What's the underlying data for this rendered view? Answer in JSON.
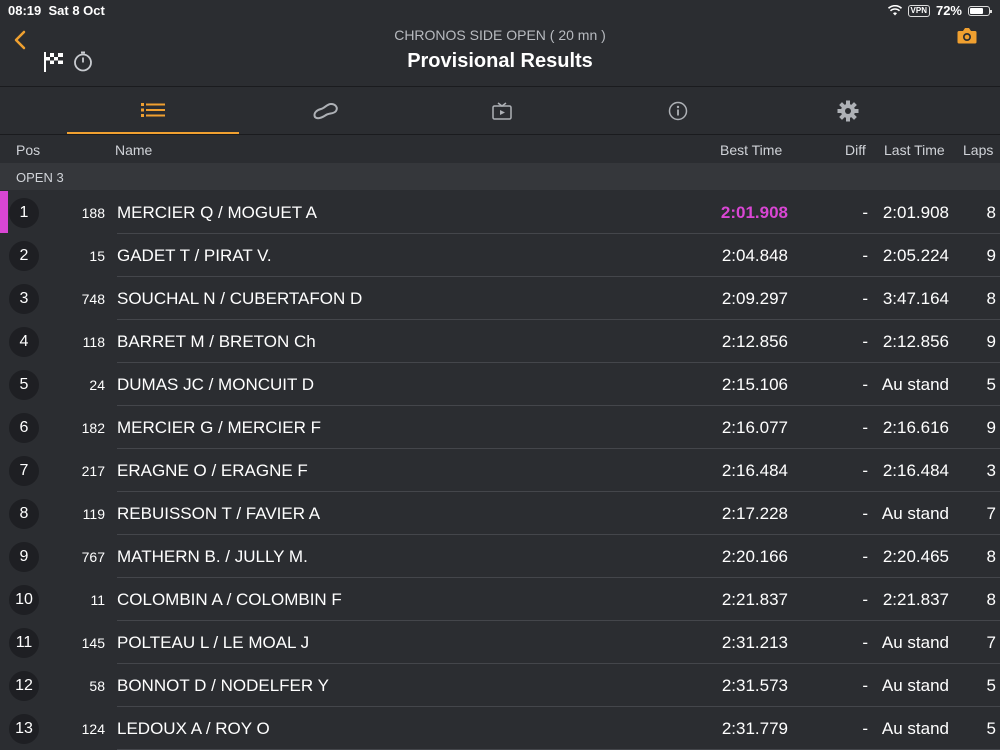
{
  "status": {
    "time": "08:19",
    "date": "Sat 8 Oct",
    "vpn": "VPN",
    "battery": "72%"
  },
  "header": {
    "subtitle": "CHRONOS SIDE OPEN ( 20 mn )",
    "title": "Provisional Results"
  },
  "colors": {
    "accent": "#f0a030",
    "fastest": "#d946d4",
    "background": "#2b2d31"
  },
  "tabs": [
    "list-icon",
    "track-icon",
    "tv-icon",
    "info-icon",
    "gear-icon"
  ],
  "columns": {
    "pos": "Pos",
    "name": "Name",
    "best": "Best Time",
    "diff": "Diff",
    "last": "Last Time",
    "laps": "Laps"
  },
  "group": "OPEN 3",
  "rows": [
    {
      "pos": "1",
      "num": "188",
      "name": "MERCIER Q / MOGUET A",
      "best": "2:01.908",
      "diff": "-",
      "last": "2:01.908",
      "laps": "8"
    },
    {
      "pos": "2",
      "num": "15",
      "name": "GADET T / PIRAT V.",
      "best": "2:04.848",
      "diff": "-",
      "last": "2:05.224",
      "laps": "9"
    },
    {
      "pos": "3",
      "num": "748",
      "name": "SOUCHAL N / CUBERTAFON D",
      "best": "2:09.297",
      "diff": "-",
      "last": "3:47.164",
      "laps": "8"
    },
    {
      "pos": "4",
      "num": "118",
      "name": "BARRET M / BRETON Ch",
      "best": "2:12.856",
      "diff": "-",
      "last": "2:12.856",
      "laps": "9"
    },
    {
      "pos": "5",
      "num": "24",
      "name": "DUMAS JC / MONCUIT D",
      "best": "2:15.106",
      "diff": "-",
      "last": "Au stand",
      "laps": "5"
    },
    {
      "pos": "6",
      "num": "182",
      "name": "MERCIER G / MERCIER F",
      "best": "2:16.077",
      "diff": "-",
      "last": "2:16.616",
      "laps": "9"
    },
    {
      "pos": "7",
      "num": "217",
      "name": "ERAGNE O / ERAGNE F",
      "best": "2:16.484",
      "diff": "-",
      "last": "2:16.484",
      "laps": "3"
    },
    {
      "pos": "8",
      "num": "119",
      "name": "REBUISSON T / FAVIER A",
      "best": "2:17.228",
      "diff": "-",
      "last": "Au stand",
      "laps": "7"
    },
    {
      "pos": "9",
      "num": "767",
      "name": "MATHERN B. / JULLY M.",
      "best": "2:20.166",
      "diff": "-",
      "last": "2:20.465",
      "laps": "8"
    },
    {
      "pos": "10",
      "num": "11",
      "name": "COLOMBIN A / COLOMBIN F",
      "best": "2:21.837",
      "diff": "-",
      "last": "2:21.837",
      "laps": "8"
    },
    {
      "pos": "11",
      "num": "145",
      "name": "POLTEAU L / LE MOAL J",
      "best": "2:31.213",
      "diff": "-",
      "last": "Au stand",
      "laps": "7"
    },
    {
      "pos": "12",
      "num": "58",
      "name": "BONNOT D / NODELFER Y",
      "best": "2:31.573",
      "diff": "-",
      "last": "Au stand",
      "laps": "5"
    },
    {
      "pos": "13",
      "num": "124",
      "name": "LEDOUX A / ROY O",
      "best": "2:31.779",
      "diff": "-",
      "last": "Au stand",
      "laps": "5"
    }
  ]
}
